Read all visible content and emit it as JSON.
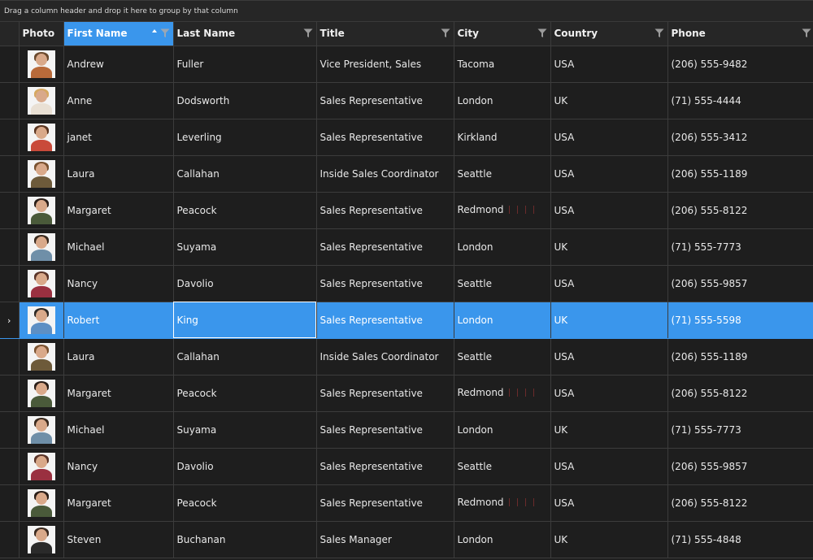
{
  "group_panel": {
    "text": "Drag a column header and drop it here to group by that column"
  },
  "columns": [
    {
      "key": "photo",
      "label": "Photo",
      "filter": false
    },
    {
      "key": "first_name",
      "label": "First Name",
      "filter": true,
      "sorted": "asc"
    },
    {
      "key": "last_name",
      "label": "Last Name",
      "filter": true
    },
    {
      "key": "title",
      "label": "Title",
      "filter": true
    },
    {
      "key": "city",
      "label": "City",
      "filter": true
    },
    {
      "key": "country",
      "label": "Country",
      "filter": true
    },
    {
      "key": "phone",
      "label": "Phone",
      "filter": true
    }
  ],
  "rows": [
    {
      "first_name": "Andrew",
      "last_name": "Fuller",
      "title": "Vice President, Sales",
      "city": "Tacoma",
      "country": "USA",
      "phone": "(206) 555-9482",
      "photo": {
        "hair": "#6b4a2e",
        "body": "#b86a3a"
      }
    },
    {
      "first_name": "Anne",
      "last_name": "Dodsworth",
      "title": "Sales Representative",
      "city": "London",
      "country": "UK",
      "phone": "(71) 555-4444",
      "photo": {
        "hair": "#d6a860",
        "body": "#e9e0d4"
      }
    },
    {
      "first_name": "janet",
      "last_name": "Leverling",
      "title": "Sales Representative",
      "city": "Kirkland",
      "country": "USA",
      "phone": "(206) 555-3412",
      "photo": {
        "hair": "#5a3520",
        "body": "#c94a3a"
      }
    },
    {
      "first_name": "Laura",
      "last_name": "Callahan",
      "title": "Inside Sales Coordinator",
      "city": "Seattle",
      "country": "USA",
      "phone": "(206) 555-1189",
      "photo": {
        "hair": "#7a5230",
        "body": "#6d5a3a"
      }
    },
    {
      "first_name": "Margaret",
      "last_name": "Peacock",
      "title": "Sales Representative",
      "city": "Redmond",
      "country": "USA",
      "phone": "(206) 555-8122",
      "photo": {
        "hair": "#2a1e18",
        "body": "#4a5a3a"
      }
    },
    {
      "first_name": "Michael",
      "last_name": "Suyama",
      "title": "Sales Representative",
      "city": "London",
      "country": "UK",
      "phone": "(71) 555-7773",
      "photo": {
        "hair": "#3a2a1e",
        "body": "#6f8fa8"
      }
    },
    {
      "first_name": "Nancy",
      "last_name": "Davolio",
      "title": "Sales Representative",
      "city": "Seattle",
      "country": "USA",
      "phone": "(206) 555-9857",
      "photo": {
        "hair": "#5a3428",
        "body": "#9a3040"
      }
    },
    {
      "first_name": "Robert",
      "last_name": "King",
      "title": "Sales Representative",
      "city": "London",
      "country": "UK",
      "phone": "(71) 555-5598",
      "photo": {
        "hair": "#2e2a26",
        "body": "#5d8fc4"
      }
    },
    {
      "first_name": "Laura",
      "last_name": "Callahan",
      "title": "Inside Sales Coordinator",
      "city": "Seattle",
      "country": "USA",
      "phone": "(206) 555-1189",
      "photo": {
        "hair": "#7a5230",
        "body": "#6d5a3a"
      }
    },
    {
      "first_name": "Margaret",
      "last_name": "Peacock",
      "title": "Sales Representative",
      "city": "Redmond",
      "country": "USA",
      "phone": "(206) 555-8122",
      "photo": {
        "hair": "#2a1e18",
        "body": "#4a5a3a"
      }
    },
    {
      "first_name": "Michael",
      "last_name": "Suyama",
      "title": "Sales Representative",
      "city": "London",
      "country": "UK",
      "phone": "(71) 555-7773",
      "photo": {
        "hair": "#3a2a1e",
        "body": "#6f8fa8"
      }
    },
    {
      "first_name": "Nancy",
      "last_name": "Davolio",
      "title": "Sales Representative",
      "city": "Seattle",
      "country": "USA",
      "phone": "(206) 555-9857",
      "photo": {
        "hair": "#5a3428",
        "body": "#9a3040"
      }
    },
    {
      "first_name": "Margaret",
      "last_name": "Peacock",
      "title": "Sales Representative",
      "city": "Redmond",
      "country": "USA",
      "phone": "(206) 555-8122",
      "photo": {
        "hair": "#2a1e18",
        "body": "#4a5a3a"
      }
    },
    {
      "first_name": "Steven",
      "last_name": "Buchanan",
      "title": "Sales Manager",
      "city": "London",
      "country": "UK",
      "phone": "(71) 555-4848",
      "photo": {
        "hair": "#3a2a20",
        "body": "#2a2a2a"
      }
    }
  ],
  "selected_row_index": 7,
  "theme": {
    "background": "#1e1e1e",
    "header_background": "#262626",
    "accent": "#3a96ec",
    "grid_line": "#3c3c3c",
    "text": "#e8e8e8"
  },
  "icons": {
    "filter": "funnel-icon",
    "sort": "sort-ascending-icon",
    "current_row": "chevron-right-icon"
  }
}
